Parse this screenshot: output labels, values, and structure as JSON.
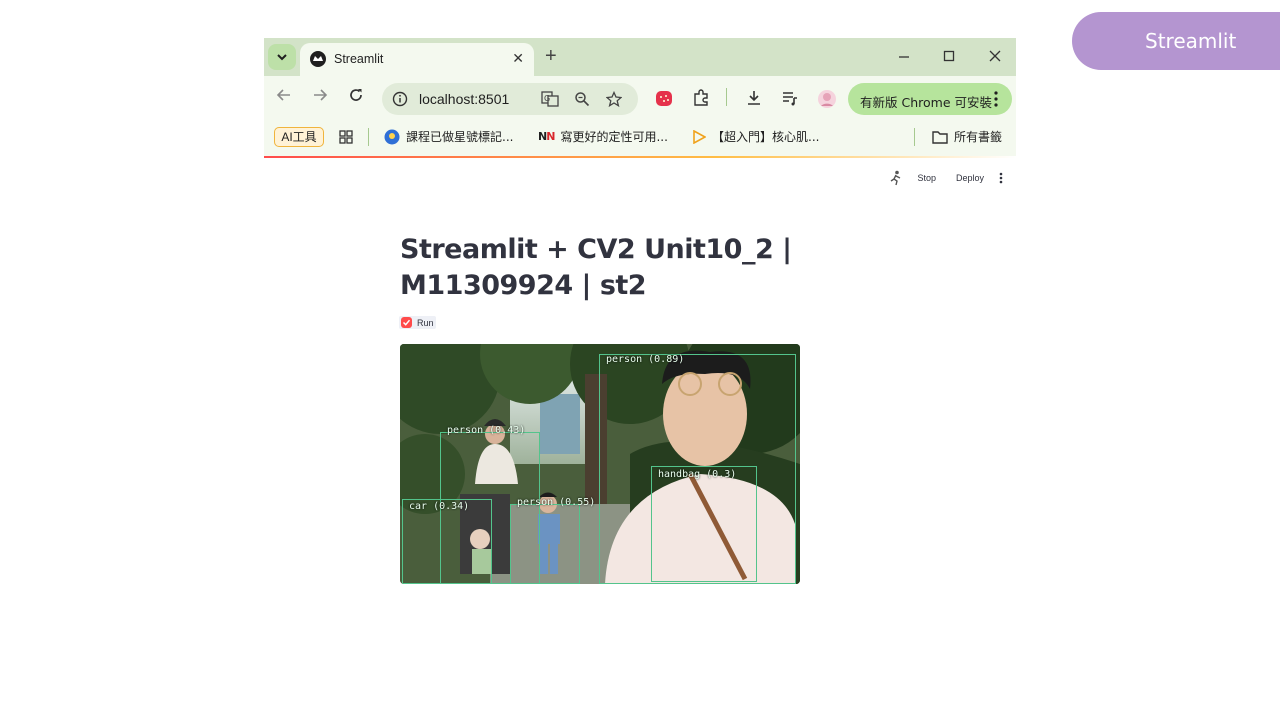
{
  "slide_badge": "Streamlit",
  "browser": {
    "tab_title": "Streamlit",
    "url": "localhost:8501",
    "update_button": "有新版 Chrome 可安裝",
    "bookmarks": {
      "ai_chip": "AI工具",
      "items": [
        "課程已做星號標記...",
        "寫更好的定性可用...",
        "【超入門】核心肌..."
      ],
      "folder": "所有書籤"
    }
  },
  "streamlit": {
    "header": {
      "stop": "Stop",
      "deploy": "Deploy"
    },
    "title_line1": "Streamlit + CV2 Unit10_2 |",
    "title_line2": "M11309924 | st2",
    "checkbox_label": "Run",
    "checkbox_checked": true,
    "detections": [
      {
        "label": "person (0.89)"
      },
      {
        "label": "person (0.43)"
      },
      {
        "label": "person (0.55)"
      },
      {
        "label": "car (0.34)"
      },
      {
        "label": "handbag (0.3)"
      }
    ]
  },
  "colors": {
    "accent": "#ff4b4b",
    "tab_strip": "#d3e3c8",
    "update_button": "#b6e49c",
    "badge": "#b495d0",
    "box": "#53c48c"
  }
}
